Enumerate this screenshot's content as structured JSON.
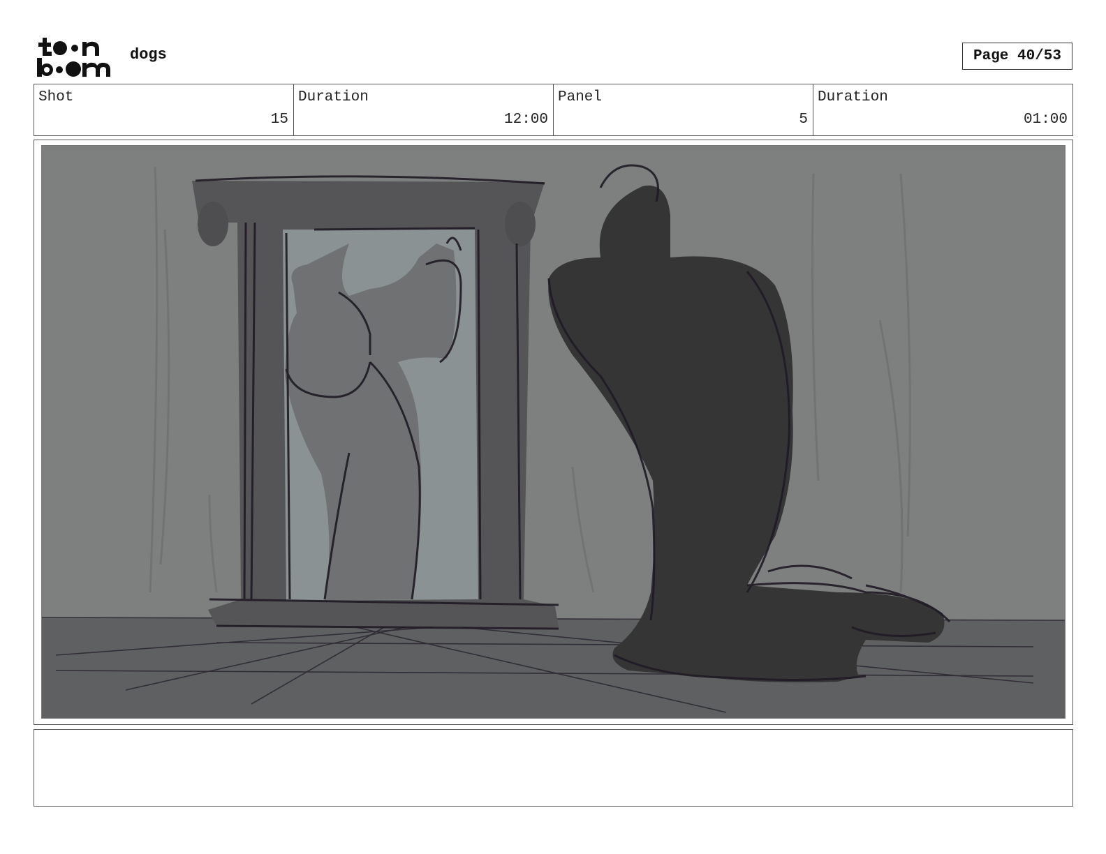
{
  "brand": {
    "logo_icon": "toonboom-logo-icon",
    "line1": "t••n",
    "line2": "b••m"
  },
  "header": {
    "project_title": "dogs",
    "page_label": "Page 40/53"
  },
  "info_bar": {
    "shot_label": "Shot",
    "shot_value": "15",
    "shot_duration_label": "Duration",
    "shot_duration_value": "12:00",
    "panel_label": "Panel",
    "panel_value": "5",
    "panel_duration_label": "Duration",
    "panel_duration_value": "01:00"
  },
  "panel_image": {
    "icon": "storyboard-sketch-image",
    "colors": {
      "wall": "#7e807f",
      "floor": "#5f6061",
      "frame": "#555557",
      "mirror": "#8a9293",
      "figure": "#353535",
      "line": "#1f1a24"
    }
  },
  "notes": {
    "text": ""
  }
}
